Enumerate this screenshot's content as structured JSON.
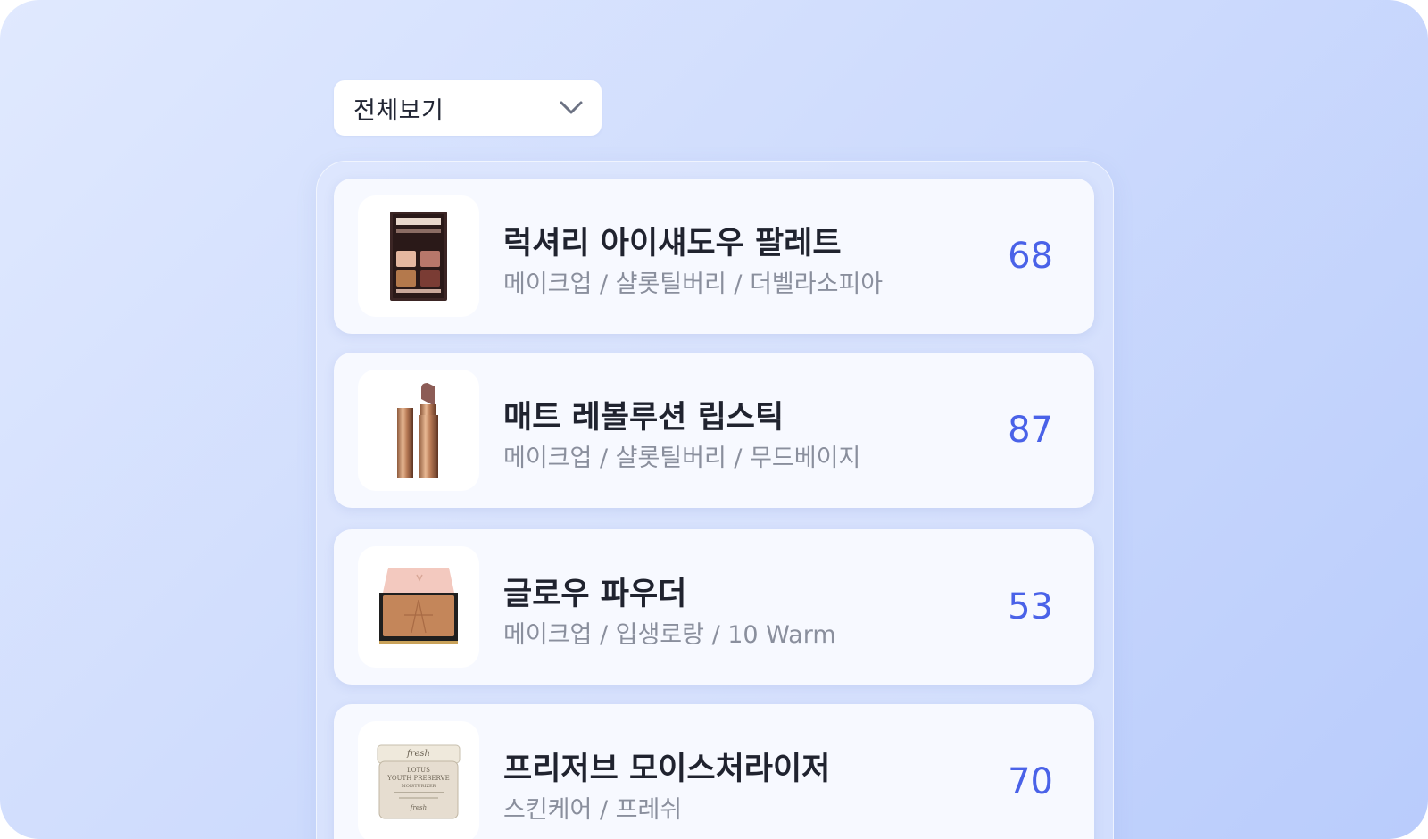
{
  "filter": {
    "label": "전체보기",
    "icon": "chevron-down-icon"
  },
  "products": [
    {
      "name": "럭셔리 아이섀도우 팔레트",
      "meta": "메이크업 / 샬롯틸버리 / 더벨라소피아",
      "score": "68",
      "image": "eyeshadow-palette-image"
    },
    {
      "name": "매트 레볼루션 립스틱",
      "meta": "메이크업 / 샬롯틸버리 / 무드베이지",
      "score": "87",
      "image": "lipstick-image"
    },
    {
      "name": "글로우 파우더",
      "meta": "메이크업 / 입생로랑 / 10 Warm",
      "score": "53",
      "image": "powder-compact-image"
    },
    {
      "name": "프리저브 모이스처라이저",
      "meta": "스킨케어 / 프레쉬",
      "score": "70",
      "image": "moisturizer-jar-image",
      "jar_text": [
        "fresh",
        "LOTUS",
        "YOUTH PRESERVE",
        "MOISTURIZER"
      ]
    }
  ],
  "colors": {
    "accent": "#4a62e8",
    "title": "#20232f",
    "subtitle": "#8a8f9d",
    "card": "#f7f9ff",
    "background_start": "#e0e9fe",
    "background_end": "#b9ccfc"
  }
}
